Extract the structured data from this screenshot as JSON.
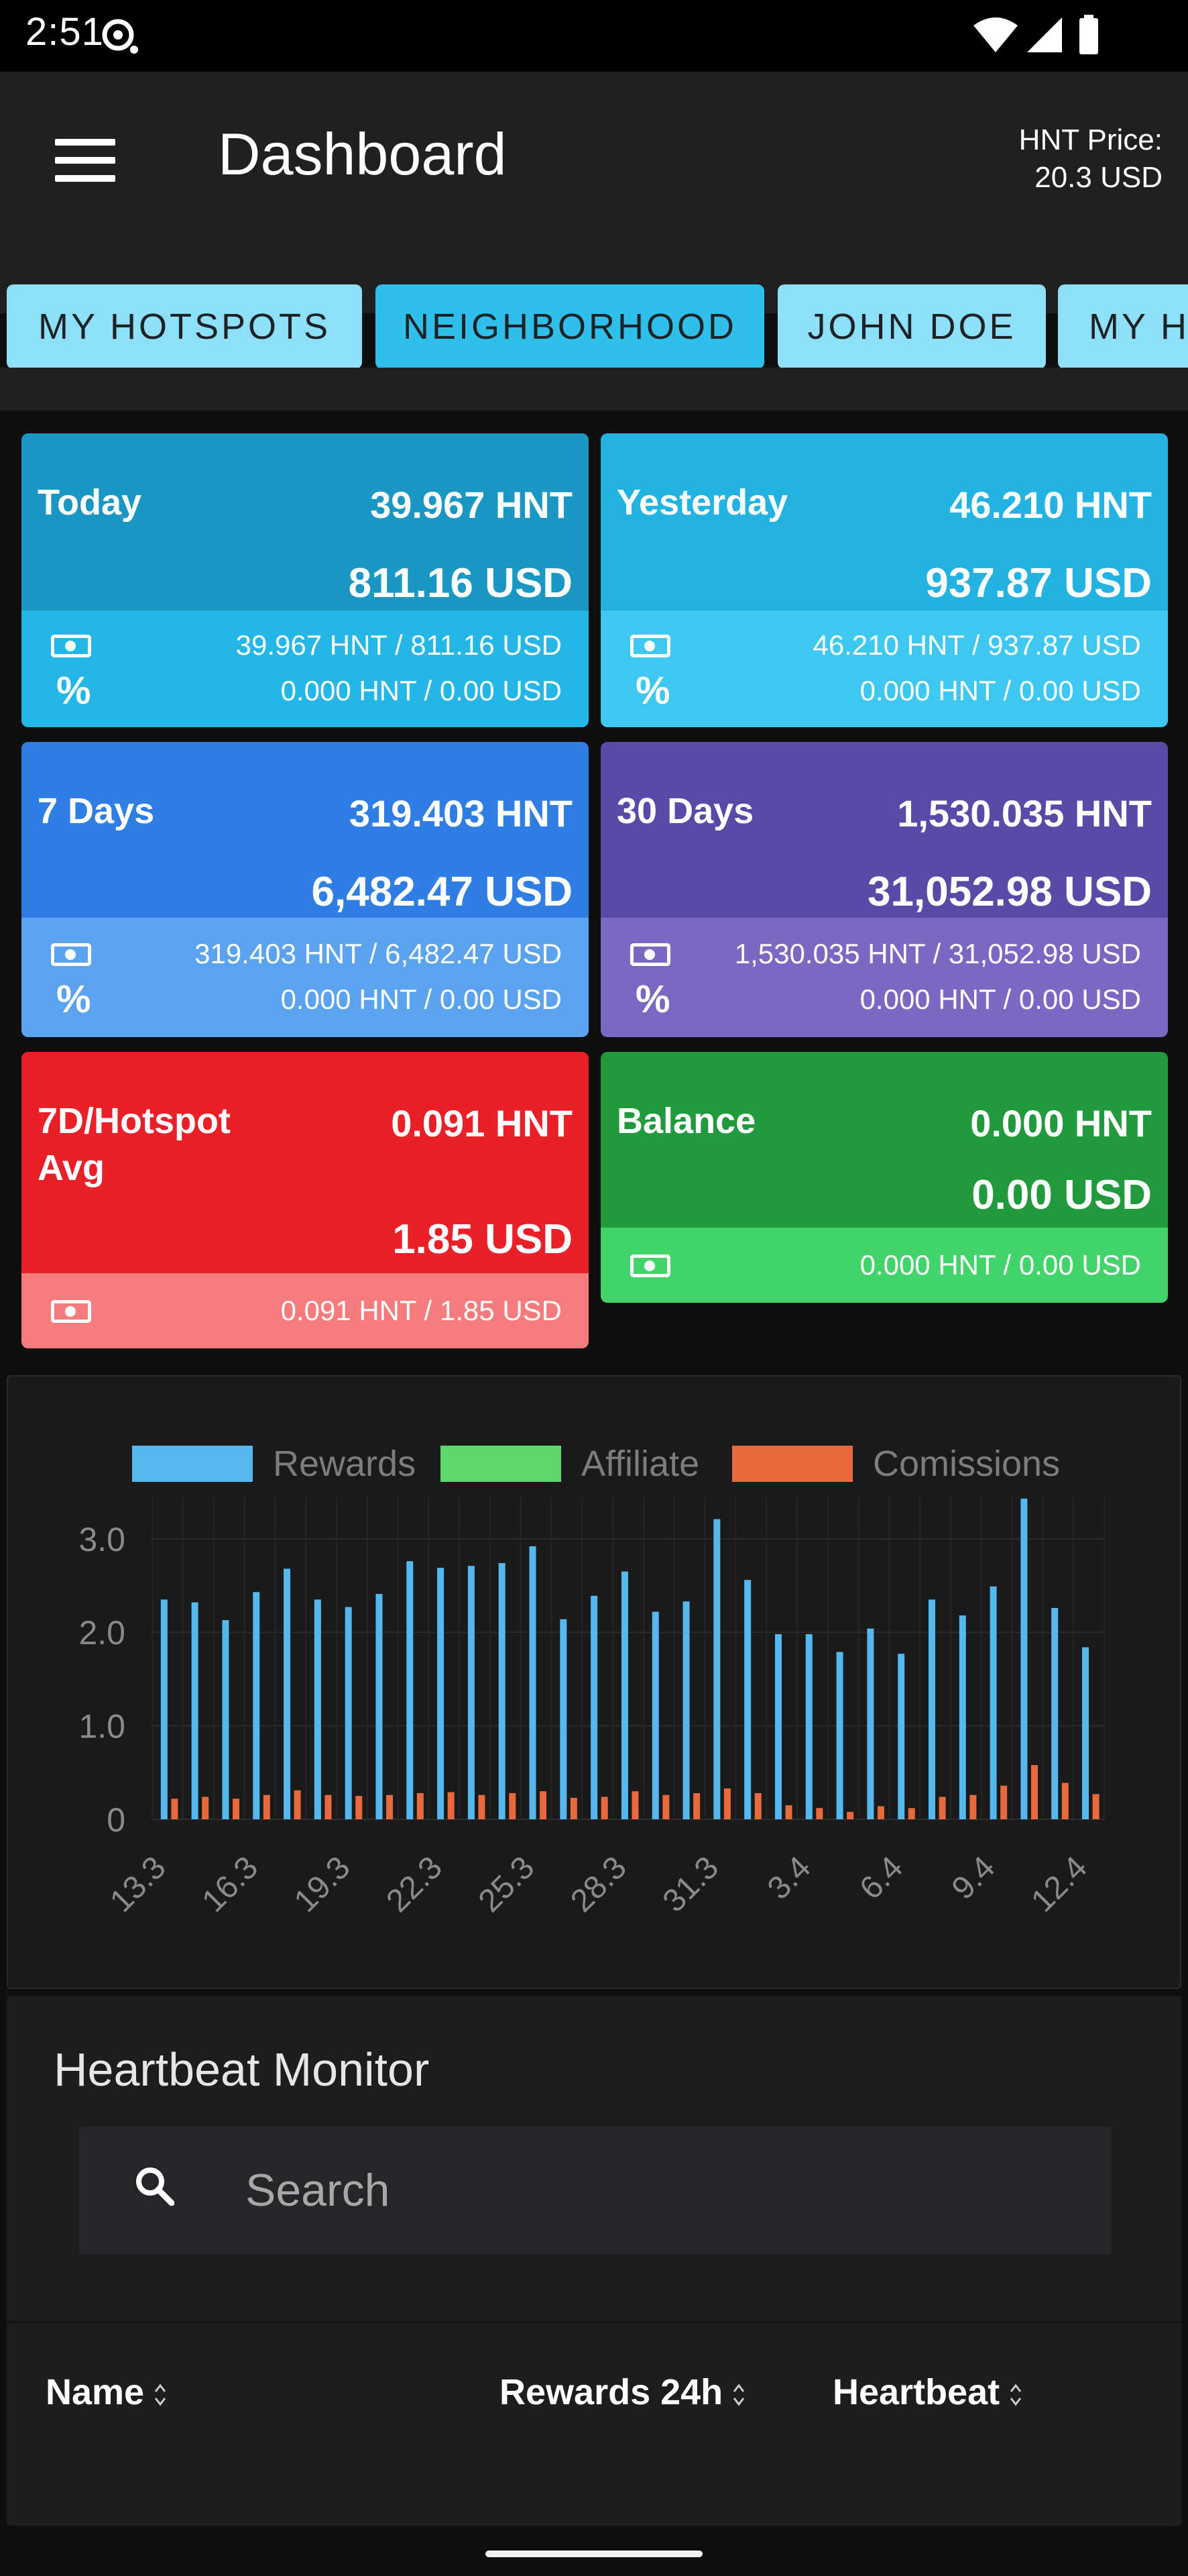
{
  "status_bar": {
    "time": "2:51"
  },
  "app_bar": {
    "title": "Dashboard",
    "price_label": "HNT Price:",
    "price_value": "20.3 USD"
  },
  "tabs": [
    {
      "label": "MY HOTSPOTS",
      "active": false
    },
    {
      "label": "NEIGHBORHOOD",
      "active": true
    },
    {
      "label": "JOHN DOE",
      "active": false
    },
    {
      "label": "MY H",
      "active": false
    }
  ],
  "cards": [
    {
      "label": "Today",
      "hnt": "39.967 HNT",
      "usd": "811.16 USD",
      "money_line": "39.967 HNT / 811.16 USD",
      "pct_line": "0.000 HNT / 0.00 USD",
      "top_color": "#1a97c3",
      "bottom_color": "#24b6e6"
    },
    {
      "label": "Yesterday",
      "hnt": "46.210 HNT",
      "usd": "937.87 USD",
      "money_line": "46.210 HNT / 937.87 USD",
      "pct_line": "0.000 HNT / 0.00 USD",
      "top_color": "#22b3e3",
      "bottom_color": "#3ec8f1"
    },
    {
      "label": "7 Days",
      "hnt": "319.403 HNT",
      "usd": "6,482.47 USD",
      "money_line": "319.403 HNT / 6,482.47 USD",
      "pct_line": "0.000 HNT / 0.00 USD",
      "top_color": "#2f7ee3",
      "bottom_color": "#5ba3ee"
    },
    {
      "label": "30 Days",
      "hnt": "1,530.035 HNT",
      "usd": "31,052.98 USD",
      "money_line": "1,530.035 HNT / 31,052.98 USD",
      "pct_line": "0.000 HNT / 0.00 USD",
      "top_color": "#5a4aa8",
      "bottom_color": "#7a68c2"
    },
    {
      "label": "7D/Hotspot Avg",
      "hnt": "0.091 HNT",
      "usd": "1.85 USD",
      "money_line": "0.091 HNT / 1.85 USD",
      "top_color": "#ea2028",
      "bottom_color": "#f57b7d"
    },
    {
      "label": "Balance",
      "hnt": "0.000 HNT",
      "usd": "0.00 USD",
      "money_line": "0.000 HNT / 0.00 USD",
      "top_color": "#219a3d",
      "bottom_color": "#42d46a"
    }
  ],
  "chart_data": {
    "type": "bar",
    "legend": [
      {
        "name": "Rewards",
        "color": "#54b8ef"
      },
      {
        "name": "Affiliate",
        "color": "#5ed86c"
      },
      {
        "name": "Comissions",
        "color": "#e8693c"
      }
    ],
    "x_tick_labels": [
      "13.3",
      "16.3",
      "19.3",
      "22.3",
      "25.3",
      "28.3",
      "31.3",
      "3.4",
      "6.4",
      "9.4",
      "12.4"
    ],
    "y_tick_labels": [
      "0",
      "1.0",
      "2.0",
      "3.0"
    ],
    "ylim": [
      0,
      3.3
    ],
    "categories": [
      "13.3",
      "14.3",
      "15.3",
      "16.3",
      "17.3",
      "18.3",
      "19.3",
      "20.3",
      "21.3",
      "22.3",
      "23.3",
      "24.3",
      "25.3",
      "26.3",
      "27.3",
      "28.3",
      "29.3",
      "30.3",
      "31.3",
      "1.4",
      "2.4",
      "3.4",
      "4.4",
      "5.4",
      "6.4",
      "7.4",
      "8.4",
      "9.4",
      "10.4",
      "11.4",
      "12.4"
    ],
    "series": [
      {
        "name": "Rewards",
        "values": [
          2.35,
          2.32,
          2.13,
          2.43,
          2.68,
          2.35,
          2.27,
          2.41,
          2.76,
          2.69,
          2.71,
          2.74,
          2.92,
          2.14,
          2.39,
          2.65,
          2.22,
          2.33,
          3.21,
          2.56,
          1.98,
          1.98,
          1.79,
          2.04,
          1.77,
          2.35,
          2.18,
          2.49,
          3.43,
          2.26,
          1.84
        ]
      },
      {
        "name": "Affiliate",
        "values": [
          0,
          0,
          0,
          0,
          0,
          0,
          0,
          0,
          0,
          0,
          0,
          0,
          0,
          0,
          0,
          0,
          0,
          0,
          0,
          0,
          0,
          0,
          0,
          0,
          0,
          0,
          0,
          0,
          0,
          0,
          0
        ]
      },
      {
        "name": "Comissions",
        "values": [
          0.22,
          0.24,
          0.22,
          0.26,
          0.31,
          0.26,
          0.25,
          0.26,
          0.28,
          0.29,
          0.26,
          0.28,
          0.3,
          0.23,
          0.24,
          0.3,
          0.26,
          0.28,
          0.33,
          0.28,
          0.15,
          0.12,
          0.08,
          0.14,
          0.12,
          0.24,
          0.26,
          0.36,
          0.58,
          0.39,
          0.27
        ]
      }
    ]
  },
  "heartbeat": {
    "title": "Heartbeat Monitor",
    "search_placeholder": "Search",
    "columns": [
      "Name",
      "Rewards 24h",
      "Heartbeat"
    ]
  }
}
